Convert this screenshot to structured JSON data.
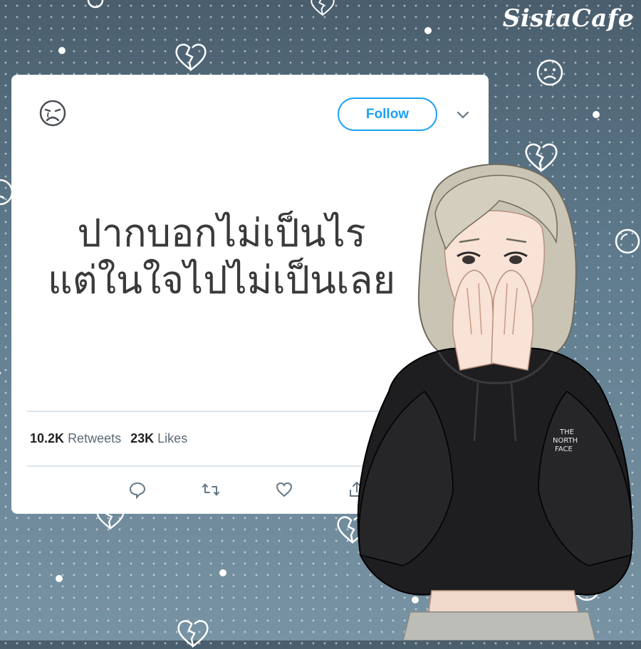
{
  "brand": {
    "logo_text": "SistaCafe"
  },
  "tweet": {
    "avatar_icon": "sad-face-icon",
    "follow_label": "Follow",
    "menu_icon": "chevron-down-icon",
    "text_line1": "ปากบอกไม่เป็นไร",
    "text_line2": "แต่ในใจไปไม่เป็นเลย",
    "retweets_count": "10.2K",
    "retweets_label": "Retweets",
    "likes_count": "23K",
    "likes_label": "Likes",
    "actions": [
      "reply-icon",
      "retweet-icon",
      "like-icon",
      "share-icon"
    ]
  },
  "colors": {
    "accent": "#1da1f2",
    "background": "#5a7384",
    "card": "#ffffff",
    "hoodie": "#1e1e20",
    "hair": "#c9c4b3"
  }
}
